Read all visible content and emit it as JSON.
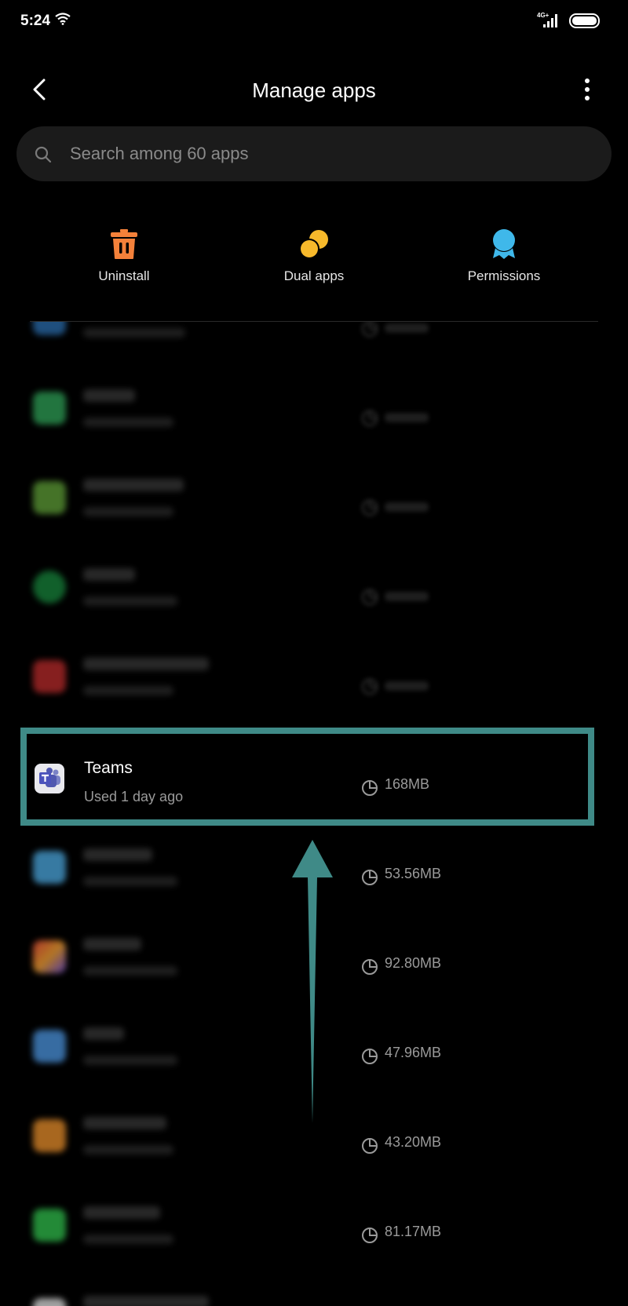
{
  "status_bar": {
    "time": "5:24",
    "network": "4G+"
  },
  "header": {
    "title": "Manage apps"
  },
  "search": {
    "placeholder": "Search among 60 apps",
    "value": ""
  },
  "actions": [
    {
      "label": "Uninstall",
      "icon": "trash-icon",
      "color": "#f4813a"
    },
    {
      "label": "Dual apps",
      "icon": "dual-circles-icon",
      "color": "#f7b92b"
    },
    {
      "label": "Permissions",
      "icon": "award-ribbon-icon",
      "color": "#3fb8ea"
    }
  ],
  "apps": [
    {
      "name": "Teams",
      "last_used": "Used 1 day ago",
      "size": "168MB"
    },
    {
      "size": "53.56MB"
    },
    {
      "size": "92.80MB"
    },
    {
      "size": "47.96MB"
    },
    {
      "size": "43.20MB"
    },
    {
      "size": "81.17MB"
    }
  ],
  "colors": {
    "background": "#000000",
    "highlight": "#3f8a87",
    "search_bg": "#1b1b1b"
  }
}
